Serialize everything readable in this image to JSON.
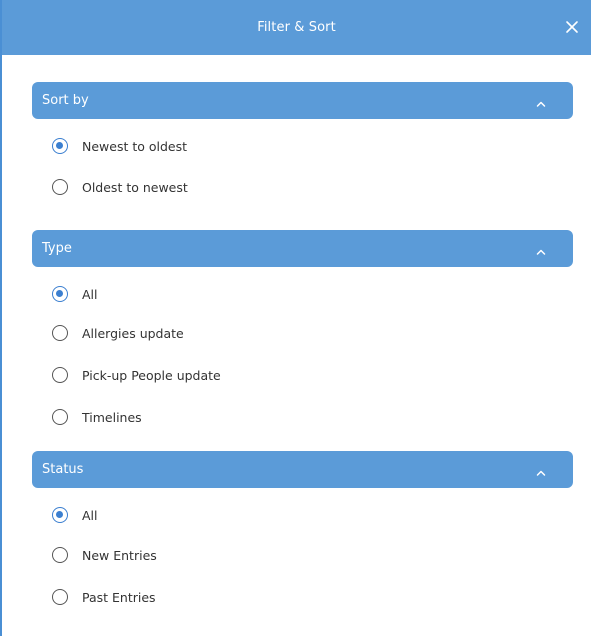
{
  "header": {
    "title": "Filter & Sort",
    "close_icon": "close-icon"
  },
  "colors": {
    "accent": "#5b9bd8",
    "radio_selected": "#3b7fd0"
  },
  "sections": [
    {
      "label": "Sort by",
      "expanded": true,
      "options": [
        {
          "label": "Newest to oldest",
          "selected": true
        },
        {
          "label": "Oldest to newest",
          "selected": false
        }
      ]
    },
    {
      "label": "Type",
      "expanded": true,
      "options": [
        {
          "label": "All",
          "selected": true
        },
        {
          "label": "Allergies update",
          "selected": false
        },
        {
          "label": "Pick-up People update",
          "selected": false
        },
        {
          "label": "Timelines",
          "selected": false
        }
      ]
    },
    {
      "label": "Status",
      "expanded": true,
      "options": [
        {
          "label": "All",
          "selected": true
        },
        {
          "label": "New Entries",
          "selected": false
        },
        {
          "label": "Past Entries",
          "selected": false
        }
      ]
    }
  ]
}
